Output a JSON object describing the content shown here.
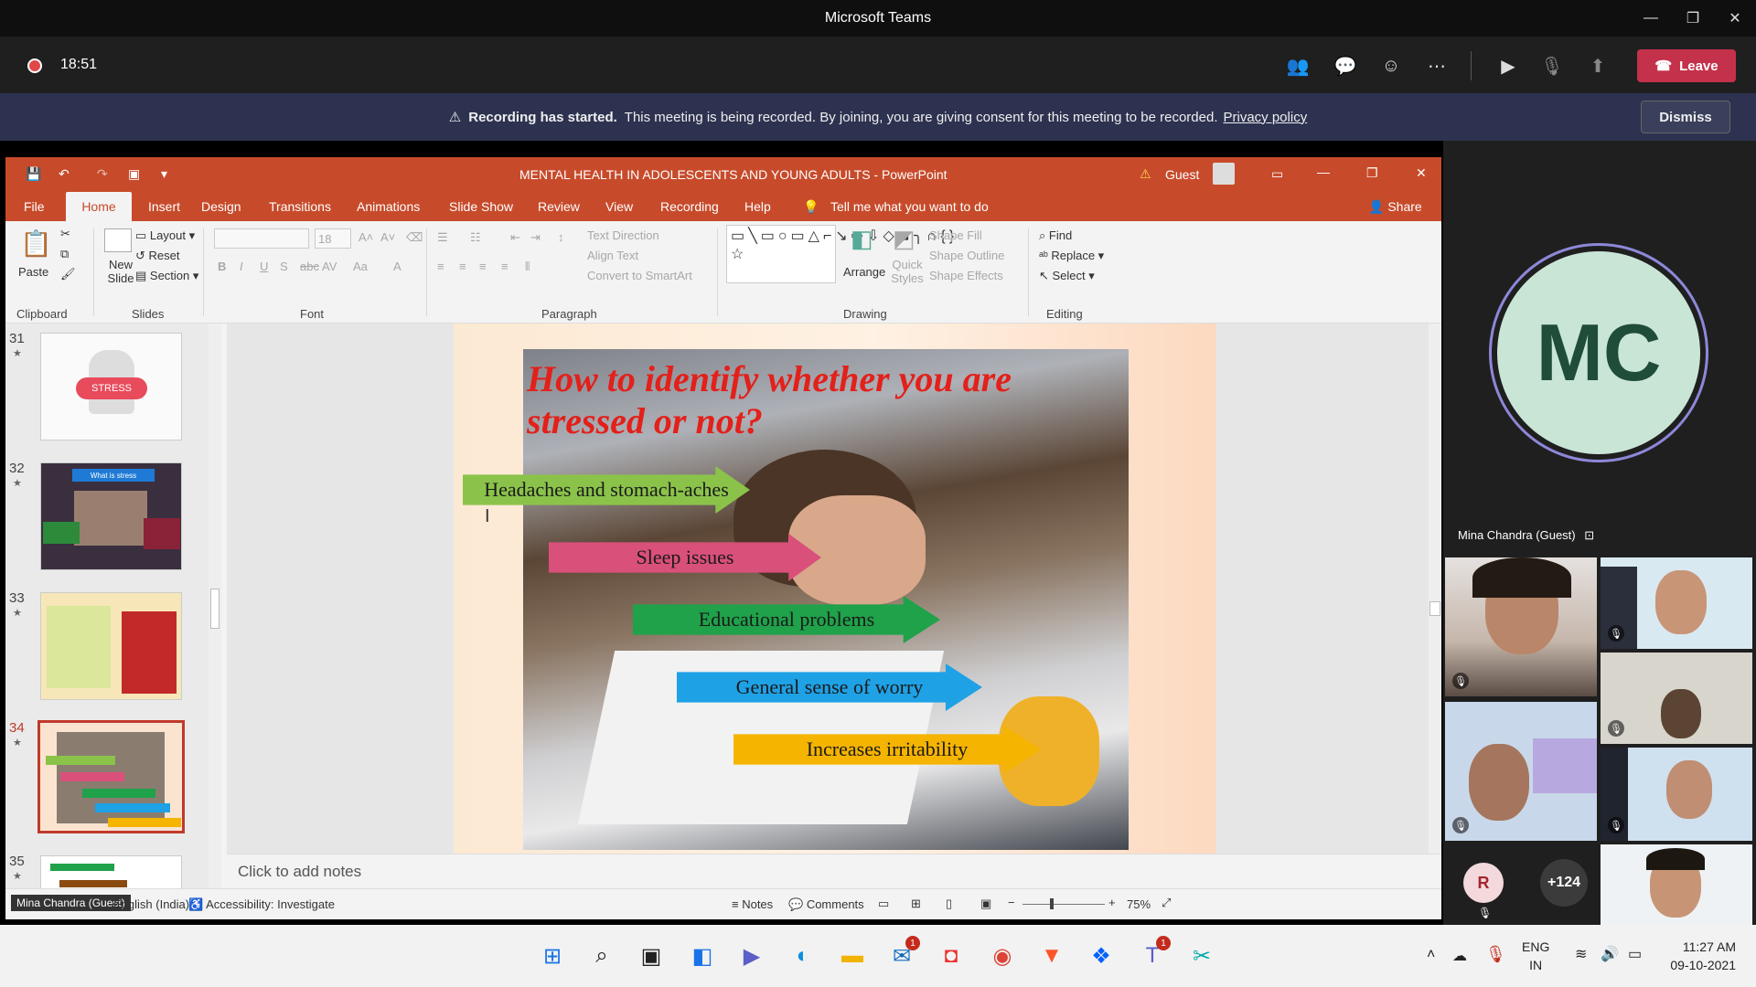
{
  "teams": {
    "window_title": "Microsoft Teams",
    "timer": "18:51",
    "leave_label": "Leave",
    "banner_bold": "Recording has started.",
    "banner_text": "This meeting is being recorded. By joining, you are giving consent for this meeting to be recorded.",
    "banner_link": "Privacy policy",
    "dismiss_label": "Dismiss"
  },
  "ppt": {
    "title": "MENTAL HEALTH IN ADOLESCENTS AND YOUNG ADULTS  -  PowerPoint",
    "user": "Guest",
    "tabs": [
      "File",
      "Home",
      "Insert",
      "Design",
      "Transitions",
      "Animations",
      "Slide Show",
      "Review",
      "View",
      "Recording",
      "Help"
    ],
    "tell_me": "Tell me what you want to do",
    "share": "Share",
    "ribbon": {
      "paste": "Paste",
      "clipboard": "Clipboard",
      "new_slide": "New Slide",
      "layout": "Layout",
      "reset": "Reset",
      "section": "Section",
      "slides": "Slides",
      "font": "Font",
      "text_direction": "Text Direction",
      "align_text": "Align Text",
      "convert_smartart": "Convert to SmartArt",
      "paragraph": "Paragraph",
      "arrange": "Arrange",
      "quick_styles": "Quick Styles",
      "shape_fill": "Shape Fill",
      "shape_outline": "Shape Outline",
      "shape_effects": "Shape Effects",
      "drawing": "Drawing",
      "find": "Find",
      "replace": "Replace",
      "select": "Select",
      "editing": "Editing",
      "font_size": "18"
    },
    "thumbs": [
      {
        "num": "31",
        "label": "STRESS"
      },
      {
        "num": "32",
        "label": "What is stress"
      },
      {
        "num": "33",
        "label": ""
      },
      {
        "num": "34",
        "label": ""
      },
      {
        "num": "35",
        "label": ""
      }
    ],
    "slide": {
      "headline": "How to identify whether you are stressed or not?",
      "arrows": [
        {
          "text": "Headaches and stomach-aches",
          "color": "#8bc34a"
        },
        {
          "text": "Sleep issues",
          "color": "#d9507a"
        },
        {
          "text": "Educational problems",
          "color": "#1fa24a"
        },
        {
          "text": "General sense of worry",
          "color": "#1fa1e6"
        },
        {
          "text": "Increases irritability",
          "color": "#f5b400"
        }
      ]
    },
    "notes_placeholder": "Click to add notes",
    "status": {
      "presenter_tag": "Mina Chandra (Guest)",
      "language": "English (India)",
      "accessibility": "Accessibility: Investigate",
      "notes": "Notes",
      "comments": "Comments",
      "zoom": "75%"
    }
  },
  "participants": {
    "featured_initials": "MC",
    "featured_name": "Mina Chandra (Guest)",
    "avatar_r": "R",
    "more_count": "+124"
  },
  "taskbar": {
    "lang_top": "ENG",
    "lang_bottom": "IN",
    "time": "11:27 AM",
    "date": "09-10-2021",
    "badge_mail": "1",
    "badge_teams": "1"
  }
}
